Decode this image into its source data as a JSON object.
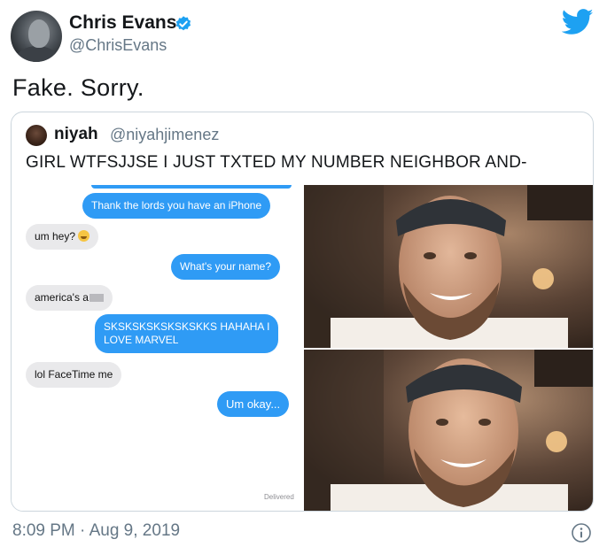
{
  "author": {
    "display_name": "Chris Evans",
    "handle": "@ChrisEvans",
    "verified": true,
    "avatar_icon": "profile-photo"
  },
  "tweet": {
    "text": "Fake. Sorry."
  },
  "quoted_tweet": {
    "display_name": "niyah",
    "handle": "@niyahjimenez",
    "text": "GIRL WTFSJJSE I JUST TXTED MY NUMBER NEIGHBOR AND-",
    "chat": {
      "messages": [
        {
          "side": "out",
          "text": "Thank the lords you have an iPhone"
        },
        {
          "side": "in",
          "text": "um hey?"
        },
        {
          "side": "out",
          "text": "What's your name?"
        },
        {
          "side": "in",
          "text": "america's a"
        },
        {
          "side": "out",
          "text": "SKSKSKSKSKSKSKKS HAHAHA I",
          "text2": "LOVE MARVEL"
        },
        {
          "side": "in",
          "text": "lol FaceTime me"
        },
        {
          "side": "out",
          "text": "Um okay..."
        }
      ],
      "status": "Delivered"
    },
    "photos": [
      "facetime-screenshot-1",
      "facetime-screenshot-2"
    ]
  },
  "footer": {
    "timestamp": "8:09 PM · Aug 9, 2019"
  },
  "colors": {
    "twitter_blue": "#1da1f2",
    "imessage_blue": "#2f9bf5",
    "imessage_gray": "#e9e9eb",
    "secondary_text": "#657786",
    "border": "#ccd6dd"
  }
}
